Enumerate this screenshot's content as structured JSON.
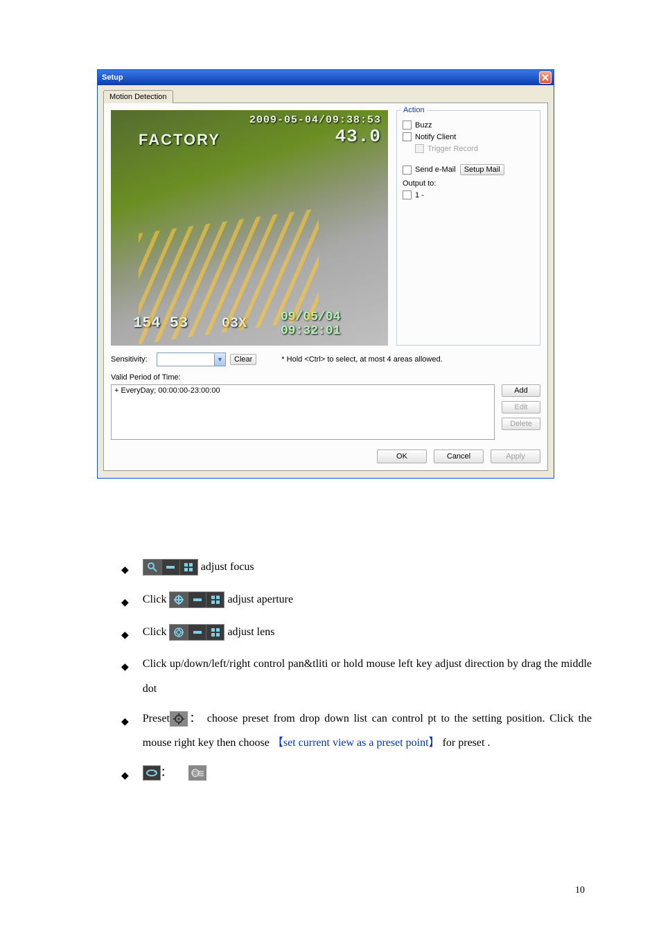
{
  "dialog": {
    "title": "Setup",
    "tab": "Motion Detection",
    "preview": {
      "timestamp_top": "2009-05-04/09:38:53",
      "value_big": "43.0",
      "name": "FACTORY",
      "bl": "154 53",
      "zoom": "03X",
      "date2": "09/05/04",
      "time2": "09:32:01"
    },
    "action": {
      "legend": "Action",
      "buzz": "Buzz",
      "notify": "Notify Client",
      "trigger": "Trigger Record",
      "send_email": "Send e-Mail",
      "setup_mail": "Setup Mail",
      "output_to": "Output to:",
      "output_opt": "1 -"
    },
    "sensitivity_label": "Sensitivity:",
    "clear": "Clear",
    "hint": "* Hold <Ctrl> to select, at most 4 areas allowed.",
    "valid_label": "Valid Period of Time:",
    "valid_item": "+ EveryDay; 00:00:00-23:00:00",
    "buttons": {
      "add": "Add",
      "edit": "Edit",
      "delete": "Delete"
    },
    "dlg": {
      "ok": "OK",
      "cancel": "Cancel",
      "apply": "Apply"
    }
  },
  "doc": {
    "b1_tail": " adjust focus",
    "b2_pre": "Click",
    "b2_tail": " adjust aperture",
    "b3_pre": "Click",
    "b3_tail": " adjust lens",
    "b4": "Click up/down/left/right control pan&tliti or hold mouse left key adjust direction by drag the middle dot",
    "b5_pre": "Preset",
    "b5_mid": "： choose preset from drop down list can control pt to the setting position. Click the mouse right key then choose  ",
    "b5_link": "【set current view as a preset point】",
    "b5_tail": " for preset .",
    "b6_colon": "："
  },
  "page_number": "10"
}
